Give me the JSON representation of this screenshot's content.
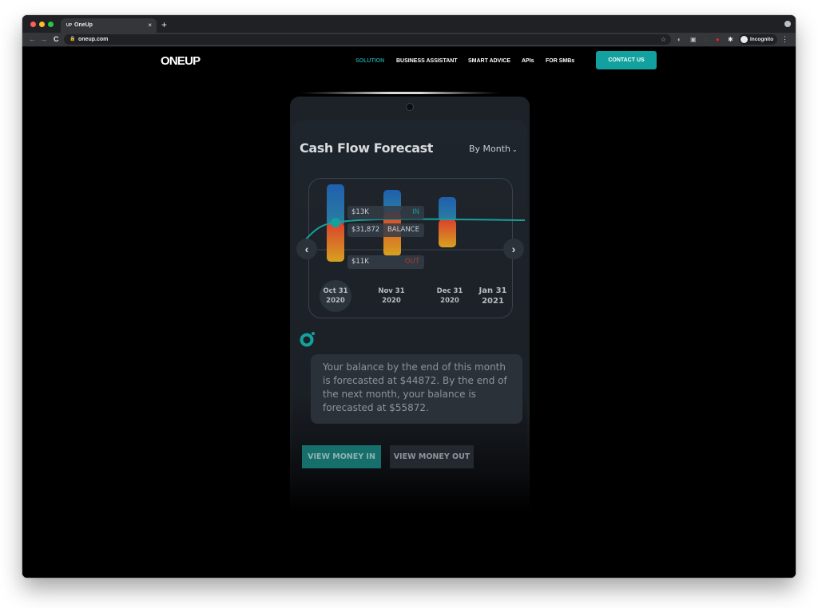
{
  "browser": {
    "tab_favicon": "UP",
    "tab_title": "OneUp",
    "tab_close": "×",
    "new_tab": "+",
    "url": "oneup.com",
    "profile_label": "Incognito",
    "icons": {
      "back": "←",
      "forward": "→",
      "reload": "C",
      "lock": "🔒",
      "star": "☆",
      "ext1": "◐",
      "ext2": "▣",
      "ext3": "⁙",
      "ext4": "●",
      "extensions": "✱",
      "menu": "⋮"
    }
  },
  "site": {
    "logo": "ONEUP",
    "nav": [
      {
        "label": "SOLUTION",
        "active": true
      },
      {
        "label": "BUSINESS ASSISTANT",
        "active": false
      },
      {
        "label": "SMART ADVICE",
        "active": false
      },
      {
        "label": "APIs",
        "active": false
      },
      {
        "label": "FOR SMBs",
        "active": false
      }
    ],
    "contact_label": "CONTACT US",
    "accent_color": "#12a19e"
  },
  "widget": {
    "title": "Cash Flow Forecast",
    "period": "By Month",
    "period_chevron": "⌄",
    "prev_icon": "‹",
    "next_icon": "›",
    "labels": {
      "in_value": "$13K",
      "in_key": "IN",
      "balance_value": "$31,872",
      "balance_key": "BALANCE",
      "out_value": "$11K",
      "out_key": "OUT"
    },
    "dates": [
      {
        "line1": "Oct 31",
        "line2": "2020",
        "selected": true
      },
      {
        "line1": "Nov 31",
        "line2": "2020",
        "selected": false
      },
      {
        "line1": "Dec 31",
        "line2": "2020",
        "selected": false
      },
      {
        "line1": "Jan 31",
        "line2": "2021",
        "selected": false
      }
    ],
    "message": "Your balance by the end of this month is forecasted at $44872. By the end of the next month, your balance is forecasted at $55872.",
    "btn_in": "VIEW MONEY IN",
    "btn_out": "VIEW MONEY OUT",
    "colors": {
      "in": "#1f5fae",
      "out": "#d9412f",
      "out_bottom": "#d8a21f",
      "balance_line": "#14a19c"
    }
  }
}
